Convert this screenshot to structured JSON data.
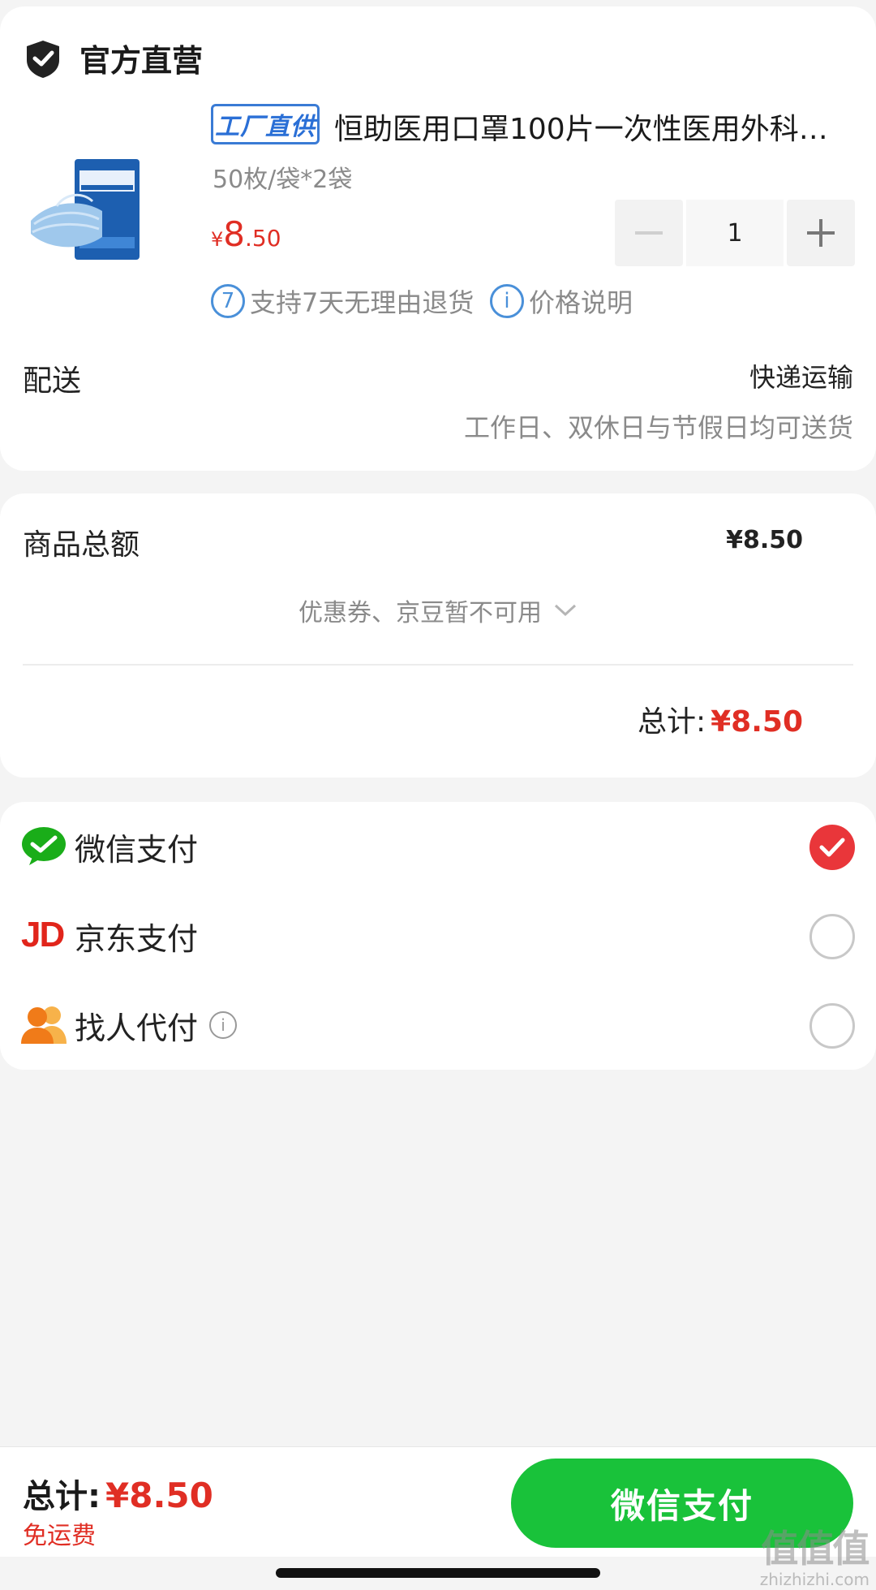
{
  "shop": {
    "name": "官方直营",
    "icon": "shield-icon"
  },
  "product": {
    "badge": "工厂直供",
    "title": "恒助医用口罩100片一次性医用外科…",
    "spec": "50枚/袋*2袋",
    "price": {
      "currency": "¥",
      "integer": "8",
      "decimal": ".50"
    },
    "quantity": "1",
    "image": "mask-package-image"
  },
  "services": [
    {
      "icon": "seven-day-return-icon",
      "icon_text": "7",
      "label": "支持7天无理由退货"
    },
    {
      "icon": "info-icon",
      "icon_text": "i",
      "label": "价格说明"
    }
  ],
  "delivery": {
    "label": "配送",
    "method": "快递运输",
    "note": "工作日、双休日与节假日均可送货"
  },
  "summary": {
    "goods_total_label": "商品总额",
    "goods_total_value": "¥8.50",
    "coupon_text": "优惠券、京豆暂不可用",
    "total_label": "总计:",
    "total_value": "¥8.50"
  },
  "payment_methods": [
    {
      "label": "微信支付",
      "icon": "wechat-pay-icon",
      "selected": true
    },
    {
      "label": "京东支付",
      "icon": "jd-pay-icon",
      "icon_text": "JD",
      "selected": false
    },
    {
      "label": "找人代付",
      "icon": "friends-pay-icon",
      "selected": false
    }
  ],
  "bottom_bar": {
    "total_label": "总计:",
    "total_value": "¥8.50",
    "free_shipping": "免运费",
    "pay_button": "微信支付"
  },
  "watermark": {
    "main": "值值值",
    "sub": "zhizhizhi.com"
  },
  "colors": {
    "price_red": "#e02e24",
    "wechat_green": "#19c23a",
    "link_blue": "#4a90d9",
    "check_red": "#e9363a"
  }
}
